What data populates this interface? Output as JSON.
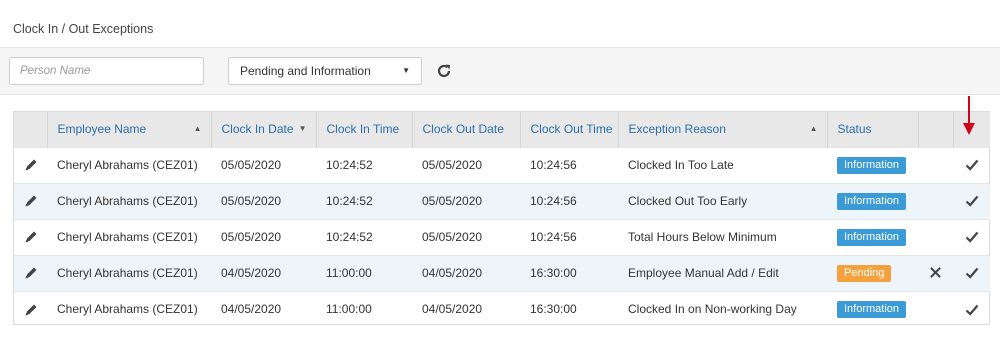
{
  "page": {
    "title": "Clock In / Out Exceptions"
  },
  "toolbar": {
    "search_placeholder": "Person Name",
    "search_value": "",
    "filter_selected": "Pending and Information",
    "refresh_icon": "refresh-icon"
  },
  "columns": [
    {
      "key": "edit",
      "label": ""
    },
    {
      "key": "employee",
      "label": "Employee Name",
      "sort": "asc"
    },
    {
      "key": "clock_in_date",
      "label": "Clock In Date",
      "sort": "desc"
    },
    {
      "key": "clock_in_time",
      "label": "Clock In Time"
    },
    {
      "key": "clock_out_date",
      "label": "Clock Out Date"
    },
    {
      "key": "clock_out_time",
      "label": "Clock Out Time"
    },
    {
      "key": "reason",
      "label": "Exception Reason",
      "sort": "asc"
    },
    {
      "key": "status",
      "label": "Status"
    },
    {
      "key": "reject",
      "label": ""
    },
    {
      "key": "approve",
      "label": ""
    }
  ],
  "rows": [
    {
      "employee": "Cheryl Abrahams (CEZ01)",
      "clock_in_date": "05/05/2020",
      "clock_in_time": "10:24:52",
      "clock_out_date": "05/05/2020",
      "clock_out_time": "10:24:56",
      "reason": "Clocked In Too Late",
      "status": "Information",
      "status_color": "#3a9bd6",
      "can_reject": false
    },
    {
      "employee": "Cheryl Abrahams (CEZ01)",
      "clock_in_date": "05/05/2020",
      "clock_in_time": "10:24:52",
      "clock_out_date": "05/05/2020",
      "clock_out_time": "10:24:56",
      "reason": "Clocked Out Too Early",
      "status": "Information",
      "status_color": "#3a9bd6",
      "can_reject": false
    },
    {
      "employee": "Cheryl Abrahams (CEZ01)",
      "clock_in_date": "05/05/2020",
      "clock_in_time": "10:24:52",
      "clock_out_date": "05/05/2020",
      "clock_out_time": "10:24:56",
      "reason": "Total Hours Below Minimum",
      "status": "Information",
      "status_color": "#3a9bd6",
      "can_reject": false
    },
    {
      "employee": "Cheryl Abrahams (CEZ01)",
      "clock_in_date": "04/05/2020",
      "clock_in_time": "11:00:00",
      "clock_out_date": "04/05/2020",
      "clock_out_time": "16:30:00",
      "reason": "Employee Manual Add / Edit",
      "status": "Pending",
      "status_color": "#f5a13d",
      "can_reject": true
    },
    {
      "employee": "Cheryl Abrahams (CEZ01)",
      "clock_in_date": "04/05/2020",
      "clock_in_time": "11:00:00",
      "clock_out_date": "04/05/2020",
      "clock_out_time": "16:30:00",
      "reason": "Clocked In on Non-working Day",
      "status": "Information",
      "status_color": "#3a9bd6",
      "can_reject": false
    }
  ],
  "colors": {
    "header_text": "#2a6fb0",
    "alt_row": "#eef5fa",
    "annotation_arrow": "#d0021b"
  }
}
